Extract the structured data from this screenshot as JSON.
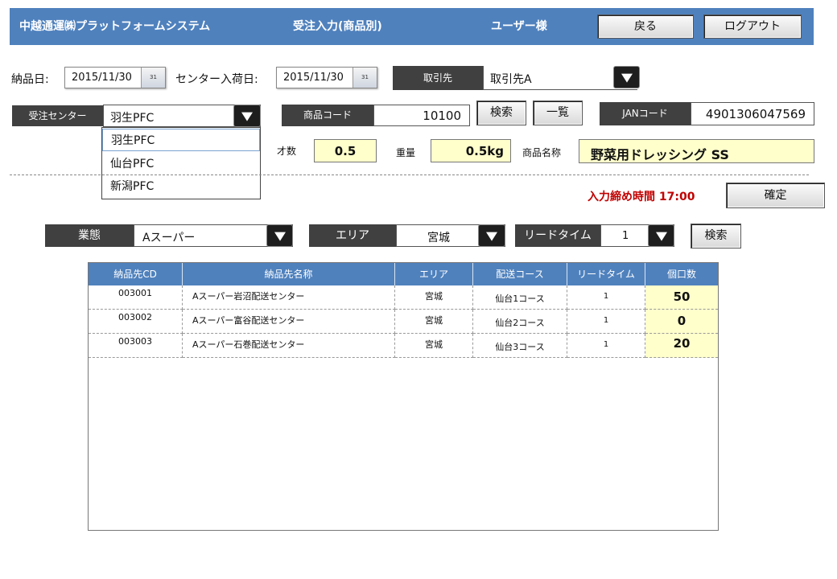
{
  "header": {
    "system_name": "中越通運㈱プラットフォームシステム",
    "screen_title": "受注入力(商品別)",
    "user": "ユーザー様",
    "back_label": "戻る",
    "logout_label": "ログアウト"
  },
  "dates": {
    "delivery_label": "納品日:",
    "delivery_value": "2015/11/30",
    "center_label": "センター入荷日:",
    "center_value": "2015/11/30",
    "calendar_glyph": "31"
  },
  "partner": {
    "label": "取引先",
    "value": "取引先A"
  },
  "order_center": {
    "label": "受注センター",
    "value": "羽生PFC",
    "options": [
      "羽生PFC",
      "仙台PFC",
      "新潟PFC"
    ]
  },
  "product": {
    "code_label": "商品コード",
    "code_value": "10100",
    "search_label": "検索",
    "list_label": "一覧",
    "jan_label": "JANコード",
    "jan_value": "4901306047569",
    "size_label": "才数",
    "size_value": "0.5",
    "weight_label": "重量",
    "weight_value": "0.5kg",
    "name_label": "商品名称",
    "name_value": "野菜用ドレッシング SS"
  },
  "deadline": {
    "text": "入力締め時間 17:00",
    "confirm_label": "確定",
    "color": "#c00000"
  },
  "filters": {
    "business_label": "業態",
    "business_value": "Aスーパー",
    "area_label": "エリア",
    "area_value": "宮城",
    "lead_label": "リードタイム",
    "lead_value": "1",
    "search_label": "検索"
  },
  "table": {
    "headers": [
      "納品先CD",
      "納品先名称",
      "エリア",
      "配送コース",
      "リードタイム",
      "個口数"
    ],
    "rows": [
      {
        "cd": "003001",
        "name": "Aスーパー岩沼配送センター",
        "area": "宮城",
        "course": "仙台1コース",
        "lead": "1",
        "qty": "50"
      },
      {
        "cd": "003002",
        "name": "Aスーパー富谷配送センター",
        "area": "宮城",
        "course": "仙台2コース",
        "lead": "1",
        "qty": "0"
      },
      {
        "cd": "003003",
        "name": "Aスーパー石巻配送センター",
        "area": "宮城",
        "course": "仙台3コース",
        "lead": "1",
        "qty": "20"
      }
    ]
  },
  "colors": {
    "header_bg": "#4f81bd",
    "dark_label": "#404040",
    "highlight": "#ffffcc"
  }
}
